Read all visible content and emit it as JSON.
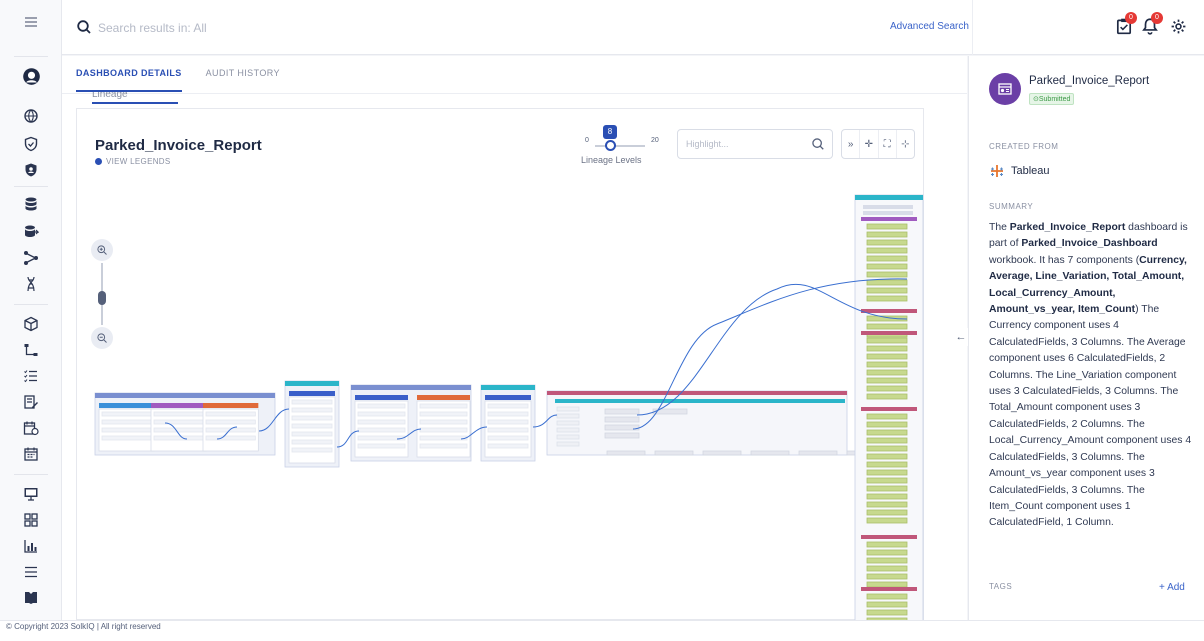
{
  "search": {
    "placeholder": "Search results in: All"
  },
  "topbar": {
    "advanced_search": "Advanced Search",
    "badge_tasks": "0",
    "badge_alerts": "0"
  },
  "tabs": [
    {
      "label": "DASHBOARD DETAILS",
      "active": true
    },
    {
      "label": "AUDIT HISTORY",
      "active": false
    }
  ],
  "subtab": {
    "label": "Lineage"
  },
  "lineage": {
    "title": "Parked_Invoice_Report",
    "view_legends": "VIEW LEGENDS",
    "levels": {
      "min": "0",
      "value": "8",
      "max": "20",
      "label": "Lineage Levels"
    },
    "highlight_placeholder": "Highlight..."
  },
  "panel": {
    "title": "Parked_Invoice_Report",
    "status": "Submitted",
    "created_from_heading": "CREATED FROM",
    "source": "Tableau",
    "summary_heading": "SUMMARY",
    "summary": {
      "t1": "The ",
      "report": "Parked_Invoice_Report",
      "t2": " dashboard is part of ",
      "dashboard": "Parked_Invoice_Dashboard",
      "t3": " workbook. It has 7 components (",
      "components": "Currency, Average, Line_Variation, Total_Amount, Local_Currency_Amount, Amount_vs_year, Item_Count",
      "t4": ") The Currency component uses 4 CalculatedFields, 3 Columns. The Average component uses 6 CalculatedFields, 2 Columns. The Line_Variation component uses 3 CalculatedFields, 3 Columns. The Total_Amount component uses 3 CalculatedFields, 2 Columns. The Local_Currency_Amount component uses 4 CalculatedFields, 3 Columns. The Amount_vs_year component uses 3 CalculatedFields, 3 Columns. The Item_Count component uses 1 CalculatedField, 1 Column."
    },
    "tags_heading": "TAGS",
    "add_tag": "+ Add"
  },
  "footer": {
    "copyright": "© Copyright 2023 SolkIQ | All right reserved"
  },
  "colors": {
    "accent": "#2a4fb4",
    "brand_purple": "#6b3fa6",
    "link": "#3a63c9",
    "node_header": "#7a8fd0",
    "field_green": "#c7d98e"
  }
}
